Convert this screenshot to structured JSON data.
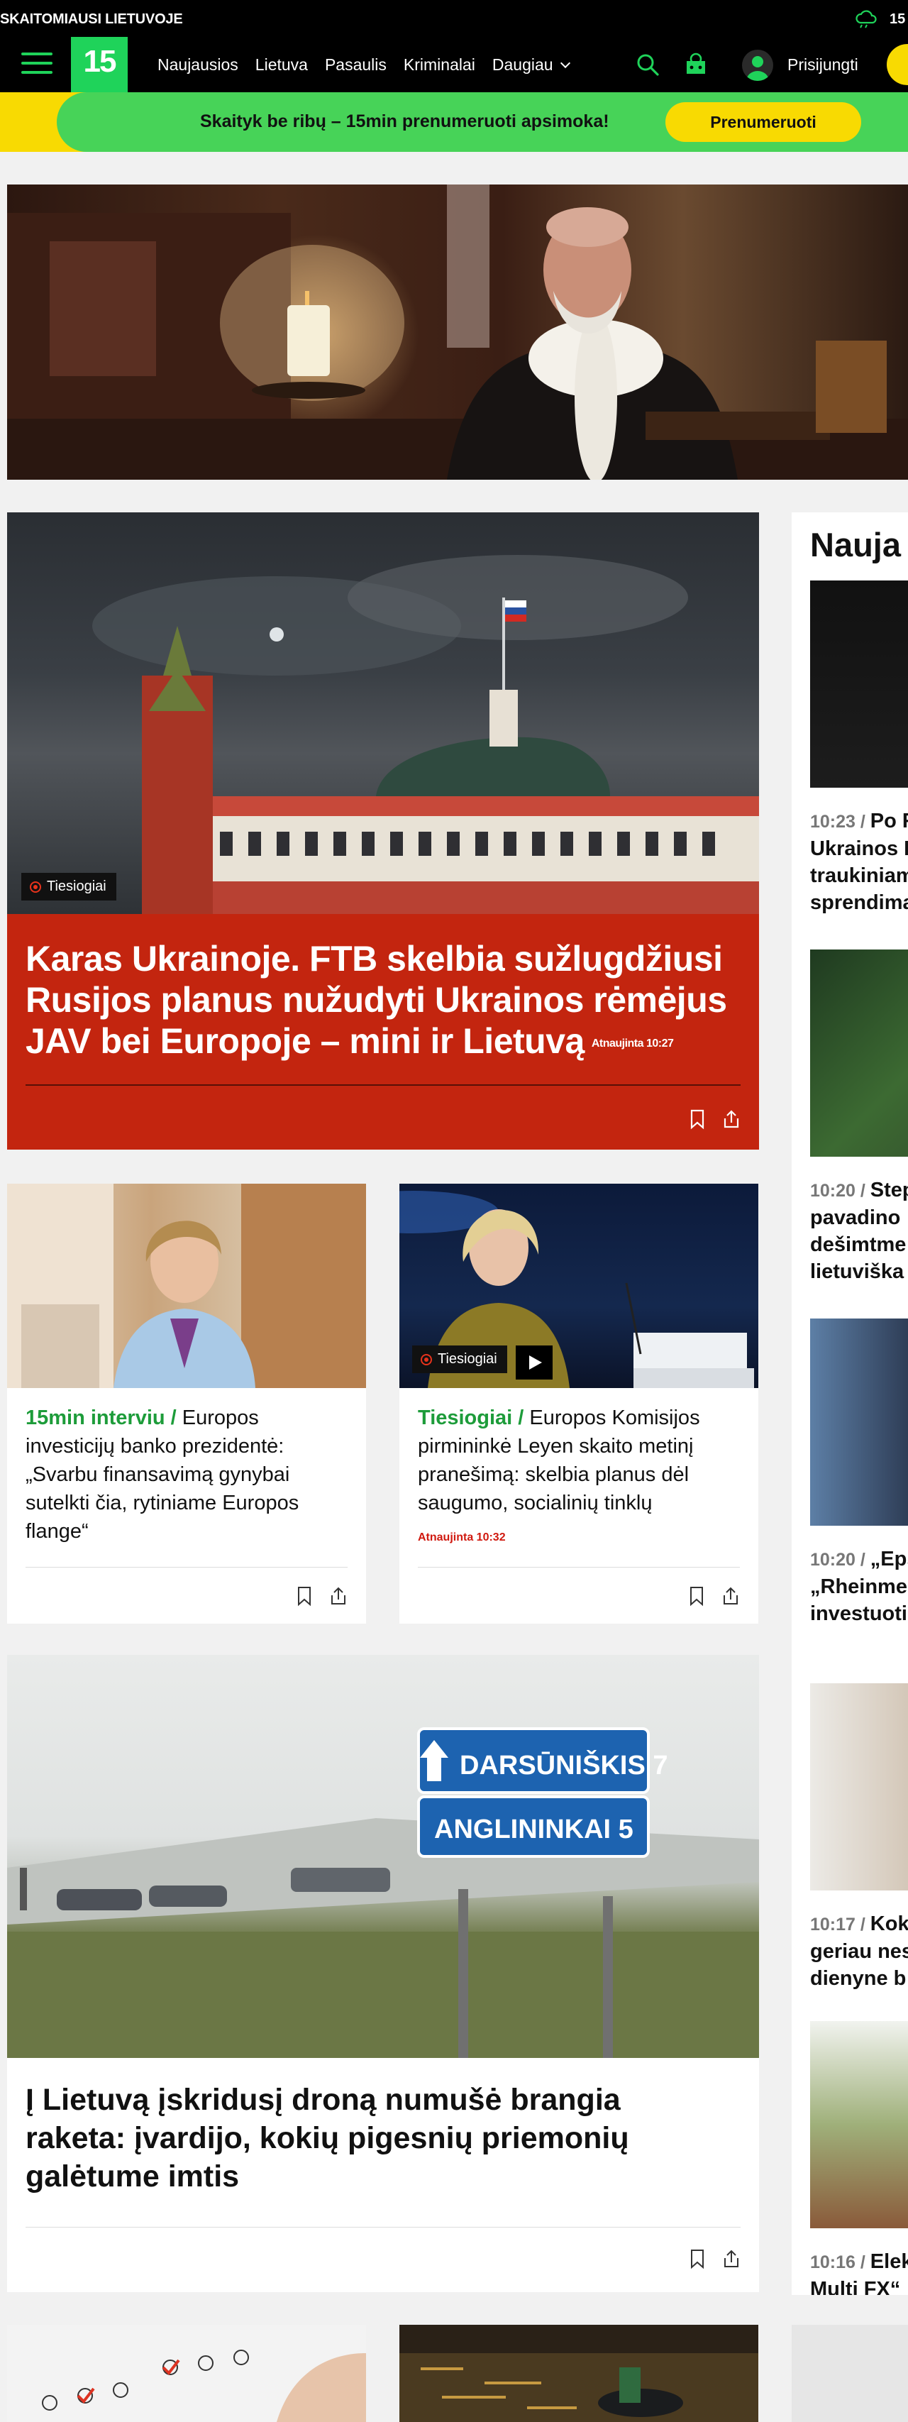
{
  "top_strip": {
    "tagline": "SKAITOMIAUSI LIETUVOJE",
    "temperature": "15"
  },
  "nav": {
    "logo": "15",
    "items": [
      "Naujausios",
      "Lietuva",
      "Pasaulis",
      "Kriminalai",
      "Daugiau"
    ],
    "login": "Prisijungti"
  },
  "subscribe": {
    "text": "Skaityk be ribų – 15min prenumeruoti apsimoka!",
    "button": "Prenumeruoti"
  },
  "lead": {
    "badge": "Tiesiogiai",
    "title": "Karas Ukrainoje. FTB skelbia sužlugdžiusi Rusijos planus nužudyti Ukrainos rėmėjus JAV bei Europoje – mini ir Lietuvą",
    "updated": "Atnaujinta 10:27"
  },
  "card1": {
    "kicker": "15min interviu",
    "separator": " / ",
    "headline": "Europos investicijų banko prezidentė: „Svarbu finansavimą gynybai sutelkti čia, rytiniame Europos flange“"
  },
  "card2": {
    "badge": "Tiesiogiai",
    "kicker": "Tiesiogiai",
    "separator": " / ",
    "headline": "Europos Komisijos pirmininkė Leyen skaito metinį pranešimą: skelbia planus dėl saugumo, socialinių tinklų",
    "updated": "Atnaujinta 10:32"
  },
  "card3": {
    "headline": "Į Lietuvą įskridusį droną numušė brangia raketa: įvardijo, kokių pigesnių priemonių galėtume imtis",
    "sign_top": "DARSŪNIŠKIS 7",
    "sign_bottom": "ANGLININKAI 5"
  },
  "sidebar": {
    "heading": "Nauja",
    "items": [
      {
        "time": "10:23",
        "sep": " / ",
        "lines": [
          "Po R",
          "Ukrainos I",
          "traukiniam",
          "sprendima"
        ]
      },
      {
        "time": "10:20",
        "sep": " / ",
        "lines": [
          "Step",
          "pavadino",
          "dešimtme",
          "lietuviška"
        ]
      },
      {
        "time": "10:20",
        "sep": " / ",
        "lines": [
          "„Eps",
          "„Rheinme",
          "investuoti"
        ]
      },
      {
        "time": "10:17",
        "sep": " / ",
        "lines": [
          "Koki",
          "geriau nes",
          "dienyne b"
        ]
      },
      {
        "time": "10:16",
        "sep": " / ",
        "lines": [
          "Elekt",
          "Multi FX“"
        ]
      }
    ]
  },
  "colors": {
    "brand_green": "#1fd35a",
    "subscribe_yellow": "#f8da02",
    "lead_red": "#c3250f",
    "kicker_green": "#1d9c3a",
    "updated_red": "#d0190f"
  },
  "icons": [
    "weather-cloud-icon",
    "menu-icon",
    "search-icon",
    "games-icon",
    "user-avatar-icon",
    "bookmark-icon",
    "share-icon",
    "live-dot-icon",
    "play-icon"
  ]
}
